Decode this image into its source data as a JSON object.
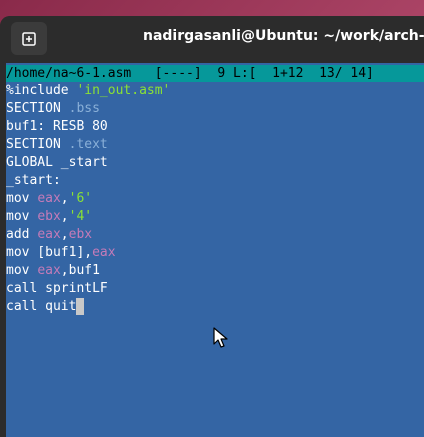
{
  "window": {
    "title": "nadirgasanli@Ubuntu: ~/work/arch-pc/l"
  },
  "status_bar": {
    "path": "/home/na~6-1.asm",
    "flags": "[----]",
    "col": "9",
    "line_info": "L:[  1+12  13/ 14]"
  },
  "code": [
    {
      "parts": [
        {
          "t": "%include ",
          "c": "kw"
        },
        {
          "t": "'in_out.asm'",
          "c": "str"
        }
      ]
    },
    {
      "parts": [
        {
          "t": "SECTION ",
          "c": "kw"
        },
        {
          "t": ".bss",
          "c": "sec"
        }
      ]
    },
    {
      "parts": [
        {
          "t": "buf1: RESB 80",
          "c": "kw"
        }
      ]
    },
    {
      "parts": [
        {
          "t": "SECTION ",
          "c": "kw"
        },
        {
          "t": ".text",
          "c": "sec"
        }
      ]
    },
    {
      "parts": [
        {
          "t": "GLOBAL _start",
          "c": "kw"
        }
      ]
    },
    {
      "parts": [
        {
          "t": "_start:",
          "c": "kw"
        }
      ]
    },
    {
      "parts": [
        {
          "t": "mov ",
          "c": "kw"
        },
        {
          "t": "eax",
          "c": "reg"
        },
        {
          "t": ",",
          "c": "kw"
        },
        {
          "t": "'6'",
          "c": "str"
        }
      ]
    },
    {
      "parts": [
        {
          "t": "mov ",
          "c": "kw"
        },
        {
          "t": "ebx",
          "c": "reg"
        },
        {
          "t": ",",
          "c": "kw"
        },
        {
          "t": "'4'",
          "c": "str"
        }
      ]
    },
    {
      "parts": [
        {
          "t": "add ",
          "c": "kw"
        },
        {
          "t": "eax",
          "c": "reg"
        },
        {
          "t": ",",
          "c": "kw"
        },
        {
          "t": "ebx",
          "c": "reg"
        }
      ]
    },
    {
      "parts": [
        {
          "t": "mov [buf1],",
          "c": "kw"
        },
        {
          "t": "eax",
          "c": "reg"
        }
      ]
    },
    {
      "parts": [
        {
          "t": "mov ",
          "c": "kw"
        },
        {
          "t": "eax",
          "c": "reg"
        },
        {
          "t": ",buf1",
          "c": "kw"
        }
      ]
    },
    {
      "parts": [
        {
          "t": "call sprintLF",
          "c": "kw"
        }
      ]
    },
    {
      "parts": [
        {
          "t": "call quit",
          "c": "kw"
        }
      ],
      "cursor": true
    }
  ],
  "icons": {
    "new_tab": "new-tab-icon",
    "mouse": "mouse-pointer-icon"
  },
  "colors": {
    "terminal_bg": "#3465a4",
    "status_bg": "#06989a",
    "string": "#8ae234",
    "register": "#c57bb8",
    "section": "#8ab0d8"
  }
}
